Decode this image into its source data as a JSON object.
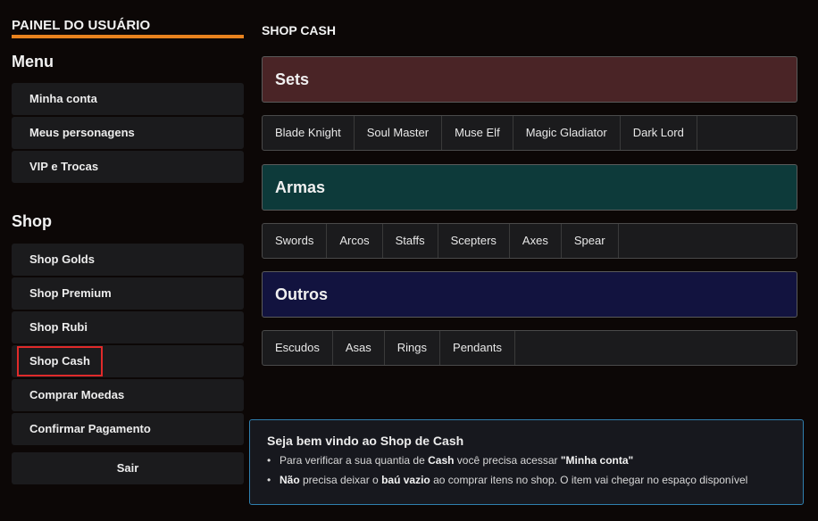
{
  "sidebar": {
    "panel_title": "PAINEL DO USUÁRIO",
    "menu_title": "Menu",
    "menu_items": [
      "Minha conta",
      "Meus personagens",
      "VIP e Trocas"
    ],
    "shop_title": "Shop",
    "shop_items": [
      "Shop Golds",
      "Shop Premium",
      "Shop Rubi",
      "Shop Cash",
      "Comprar Moedas",
      "Confirmar Pagamento"
    ],
    "active_item": "Shop Cash",
    "logout_label": "Sair"
  },
  "main": {
    "title": "SHOP CASH",
    "categories": [
      {
        "label": "Sets",
        "color": "#4a2426",
        "tabs": [
          "Blade Knight",
          "Soul Master",
          "Muse Elf",
          "Magic Gladiator",
          "Dark Lord"
        ]
      },
      {
        "label": "Armas",
        "color": "#0d3a3a",
        "tabs": [
          "Swords",
          "Arcos",
          "Staffs",
          "Scepters",
          "Axes",
          "Spear"
        ]
      },
      {
        "label": "Outros",
        "color": "#12133f",
        "tabs": [
          "Escudos",
          "Asas",
          "Rings",
          "Pendants"
        ]
      }
    ]
  },
  "info": {
    "title": "Seja bem vindo ao Shop de Cash",
    "line1": {
      "pre": "Para verificar a sua quantia de ",
      "b1": "Cash",
      "mid": " você precisa acessar ",
      "b2": "\"Minha conta\""
    },
    "line2": {
      "b1": "Não",
      "pre": " precisa deixar o ",
      "b2": "baú vazio",
      "post": " ao comprar itens no shop. O item vai chegar no espaço disponível"
    },
    "bullet": "•"
  },
  "colors": {
    "accent": "#e8821e",
    "active_outline": "#e02a2a",
    "info_border": "#2f7fae"
  }
}
